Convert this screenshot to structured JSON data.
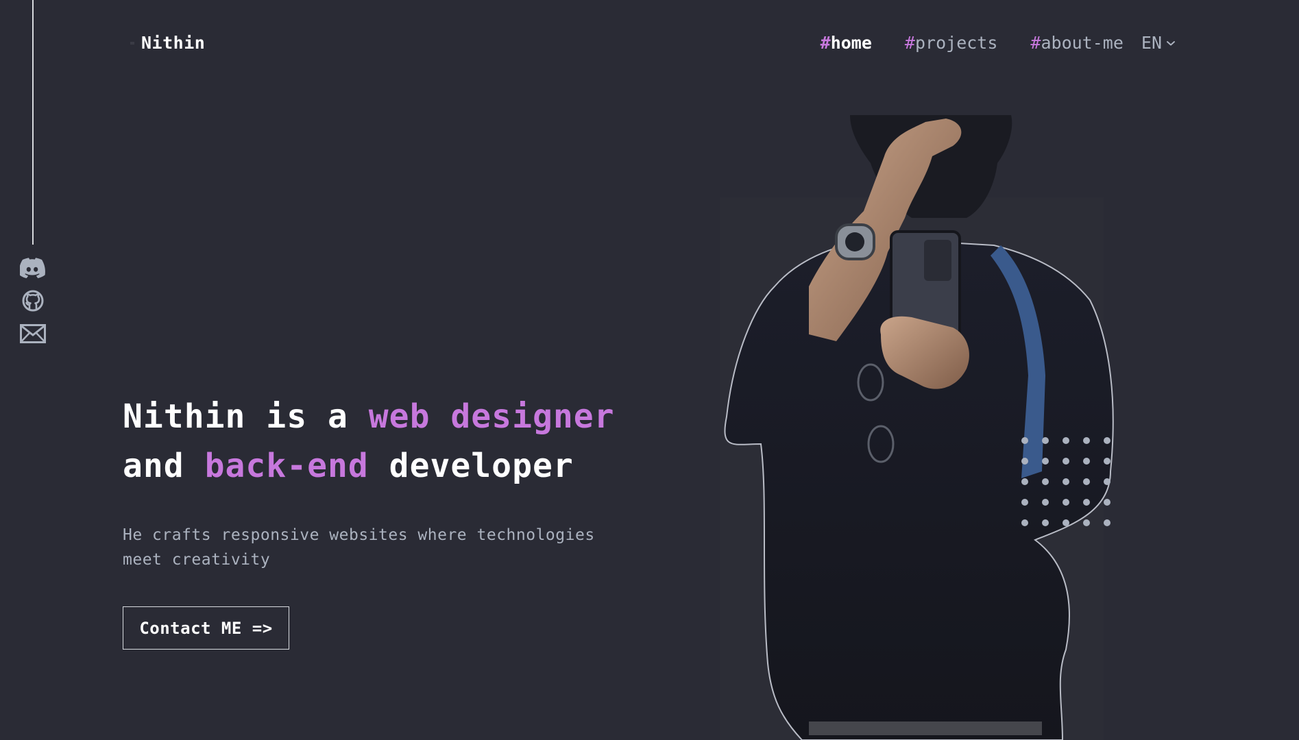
{
  "header": {
    "logo_text": "Nithin",
    "nav": [
      {
        "hash": "#",
        "label": "home",
        "active": true
      },
      {
        "hash": "#",
        "label": "projects",
        "active": false
      },
      {
        "hash": "#",
        "label": "about-me",
        "active": false
      }
    ],
    "language": "EN"
  },
  "social": [
    {
      "name": "discord-icon"
    },
    {
      "name": "github-icon"
    },
    {
      "name": "email-icon"
    }
  ],
  "hero": {
    "title_part1": "Nithin is a ",
    "title_accent1": "web designer",
    "title_part2": "and ",
    "title_accent2": "back-end",
    "title_part3": " developer",
    "subtitle": "He crafts responsive websites where technologies meet creativity",
    "cta_label": "Contact ME =>"
  },
  "colors": {
    "background": "#2a2b35",
    "accent": "#c778dd",
    "muted_text": "#abb2bf",
    "text": "#ffffff"
  }
}
